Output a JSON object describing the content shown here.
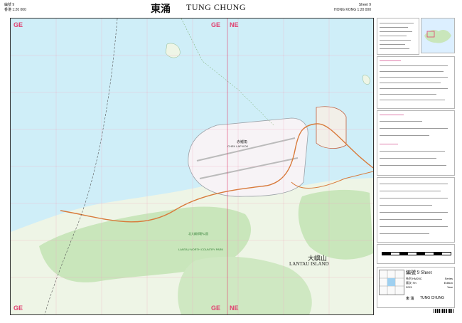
{
  "header": {
    "left_line1": "編號 9",
    "left_line2": "香港 1:20 000",
    "title_cn": "東涌",
    "title_en": "TUNG CHUNG",
    "right_line1": "Sheet 9",
    "right_line2": "HONG KONG 1:20 000"
  },
  "map": {
    "grid_labels": [
      "GE",
      "GE",
      "NE",
      "GE",
      "GE",
      "NE"
    ],
    "place_labels": {
      "airport_cn": "赤鱲角",
      "airport_en": "CHEK LAP KOK",
      "lantau_cn": "大嶼山",
      "lantau_en": "LANTAU  ISLAND",
      "country_park_cn": "北大嶼郊野公園",
      "country_park_en": "LANTAU NORTH COUNTRY PARK"
    }
  },
  "panel": {
    "sheet_label": "編號  9  Sheet",
    "rows": [
      {
        "k": "系列",
        "v": "HM20C",
        "e": "Series"
      },
      {
        "k": "版次",
        "v": "7th",
        "e": "Edition"
      },
      {
        "k": "",
        "v": "2021",
        "e": "Year"
      }
    ],
    "footer_cn": "東 涌",
    "footer_en": "TUNG  CHUNG"
  },
  "colors": {
    "sea": "#cfeef8",
    "land": "#f4f8ee",
    "vegetation": "#c9e6bb",
    "road": "#d87a3a",
    "grid": "#e04070",
    "airport": "#f7f3f6"
  }
}
